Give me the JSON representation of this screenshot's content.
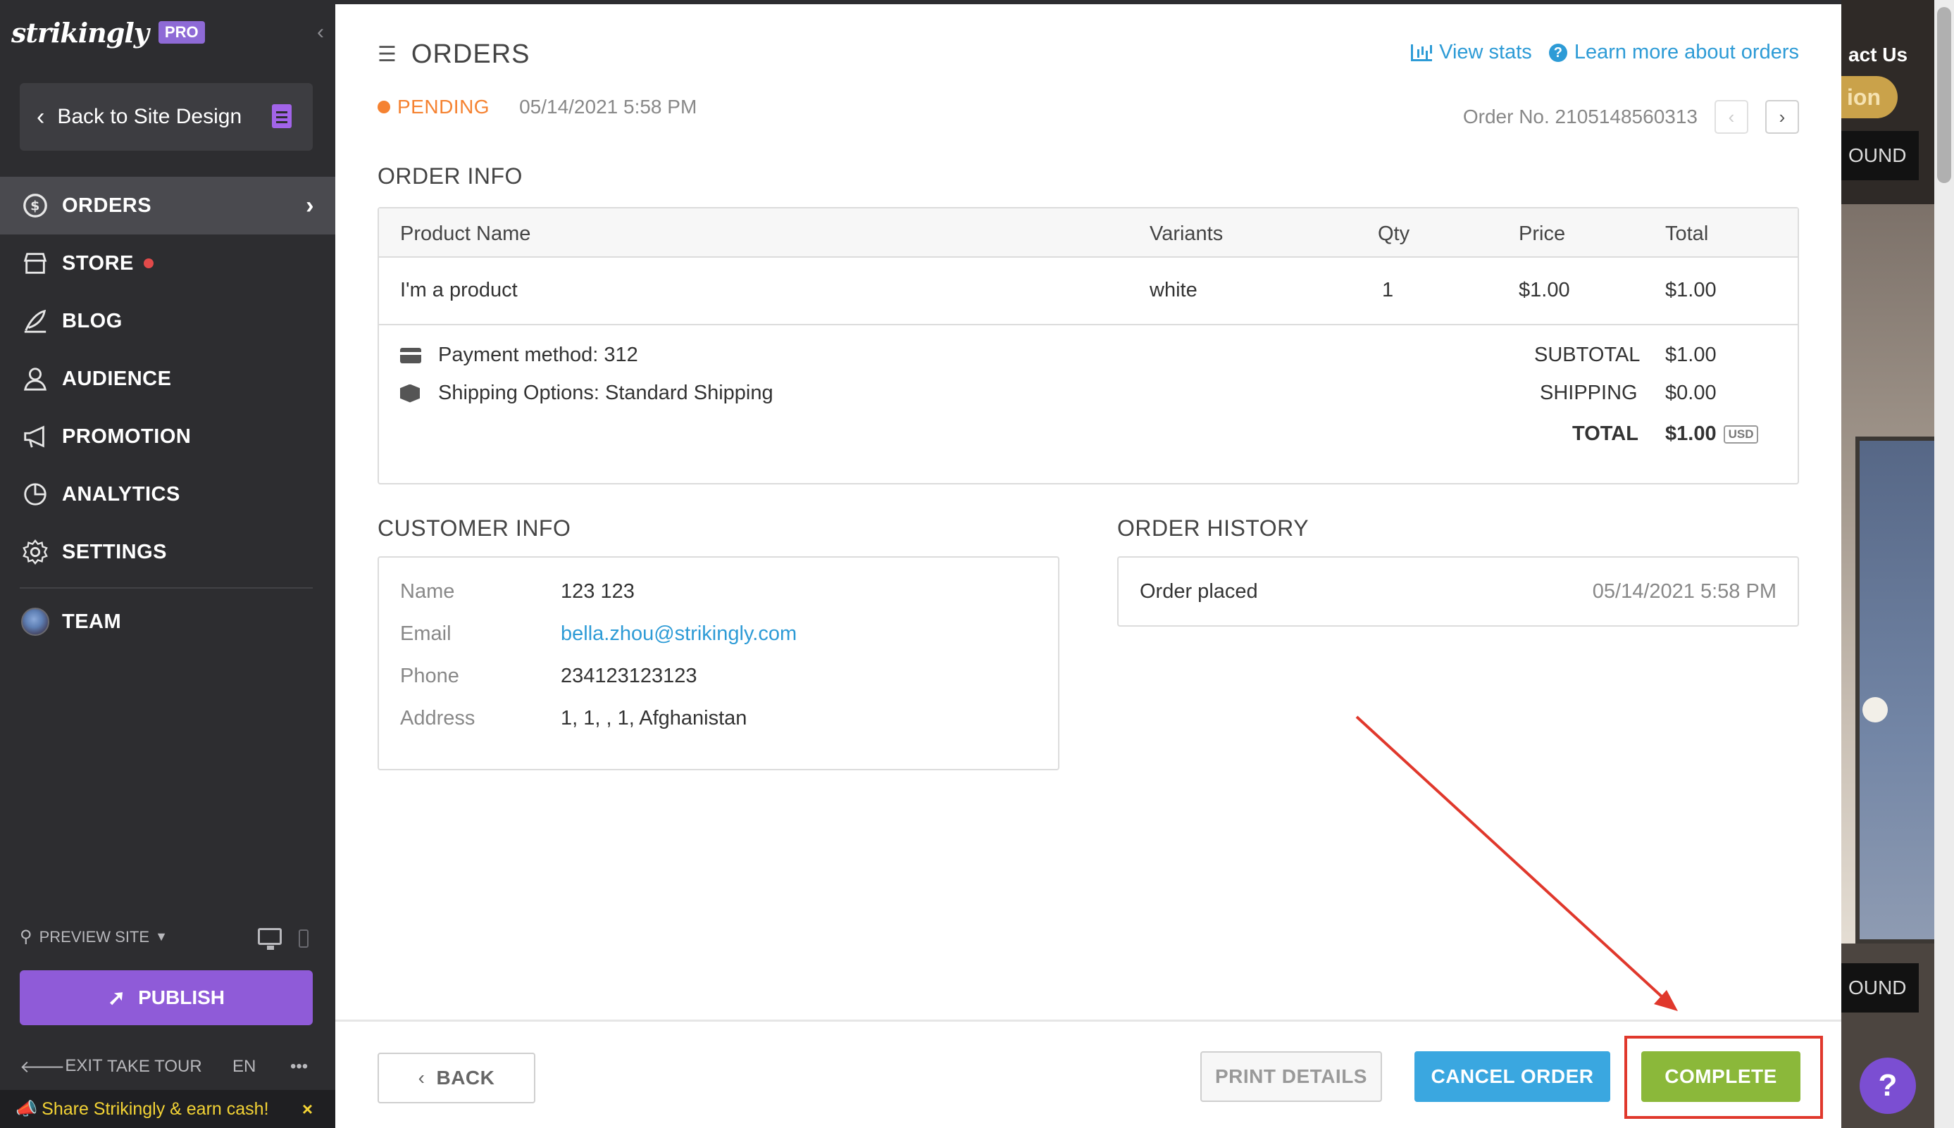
{
  "sidebar": {
    "logo": "strikingly",
    "pro_badge": "PRO",
    "back_to_site": "Back to Site Design",
    "nav": [
      {
        "label": "ORDERS"
      },
      {
        "label": "STORE"
      },
      {
        "label": "BLOG"
      },
      {
        "label": "AUDIENCE"
      },
      {
        "label": "PROMOTION"
      },
      {
        "label": "ANALYTICS"
      },
      {
        "label": "SETTINGS"
      },
      {
        "label": "TEAM"
      }
    ],
    "preview_site": "PREVIEW SITE",
    "publish": "PUBLISH",
    "exit": "EXIT",
    "take_tour": "TAKE TOUR",
    "language": "EN",
    "more": "•••",
    "share_bar": "Share Strikingly & earn cash!",
    "share_close": "×"
  },
  "header": {
    "title": "ORDERS",
    "view_stats": "View stats",
    "learn_more": "Learn more about orders",
    "status": "PENDING",
    "date": "05/14/2021 5:58 PM",
    "order_no": "Order No. 2105148560313"
  },
  "order_info": {
    "title": "ORDER INFO",
    "columns": [
      "Product Name",
      "Variants",
      "Qty",
      "Price",
      "Total"
    ],
    "rows": [
      [
        "I'm a product",
        "white",
        "1",
        "$1.00",
        "$1.00"
      ]
    ],
    "payment_method": "Payment method: 312",
    "shipping_options": "Shipping Options: Standard Shipping",
    "subtotal_label": "SUBTOTAL",
    "subtotal_value": "$1.00",
    "shipping_label": "SHIPPING",
    "shipping_value": "$0.00",
    "total_label": "TOTAL",
    "total_value": "$1.00",
    "currency": "USD"
  },
  "customer_info": {
    "title": "CUSTOMER INFO",
    "fields": [
      {
        "label": "Name",
        "value": "123 123"
      },
      {
        "label": "Email",
        "value": "bella.zhou@strikingly.com"
      },
      {
        "label": "Phone",
        "value": "234123123123"
      },
      {
        "label": "Address",
        "value": "1, 1, , 1, Afghanistan"
      }
    ]
  },
  "order_history": {
    "title": "ORDER HISTORY",
    "events": [
      {
        "label": "Order placed",
        "time": "05/14/2021 5:58 PM"
      }
    ]
  },
  "footer": {
    "back": "BACK",
    "print": "PRINT DETAILS",
    "cancel": "CANCEL ORDER",
    "complete": "COMPLETE"
  },
  "background_site": {
    "contact": "act Us",
    "pill": "ion",
    "found_1": "OUND",
    "found_2": "OUND"
  },
  "help": "?",
  "colors": {
    "sidebar_bg": "#2d2d30",
    "accent_purple": "#8f5bd8",
    "link_blue": "#2d9bd6",
    "pending_orange": "#f58231",
    "complete_green": "#8bb83a",
    "cancel_blue": "#3aa7e0",
    "annotation_red": "#e0382c"
  }
}
